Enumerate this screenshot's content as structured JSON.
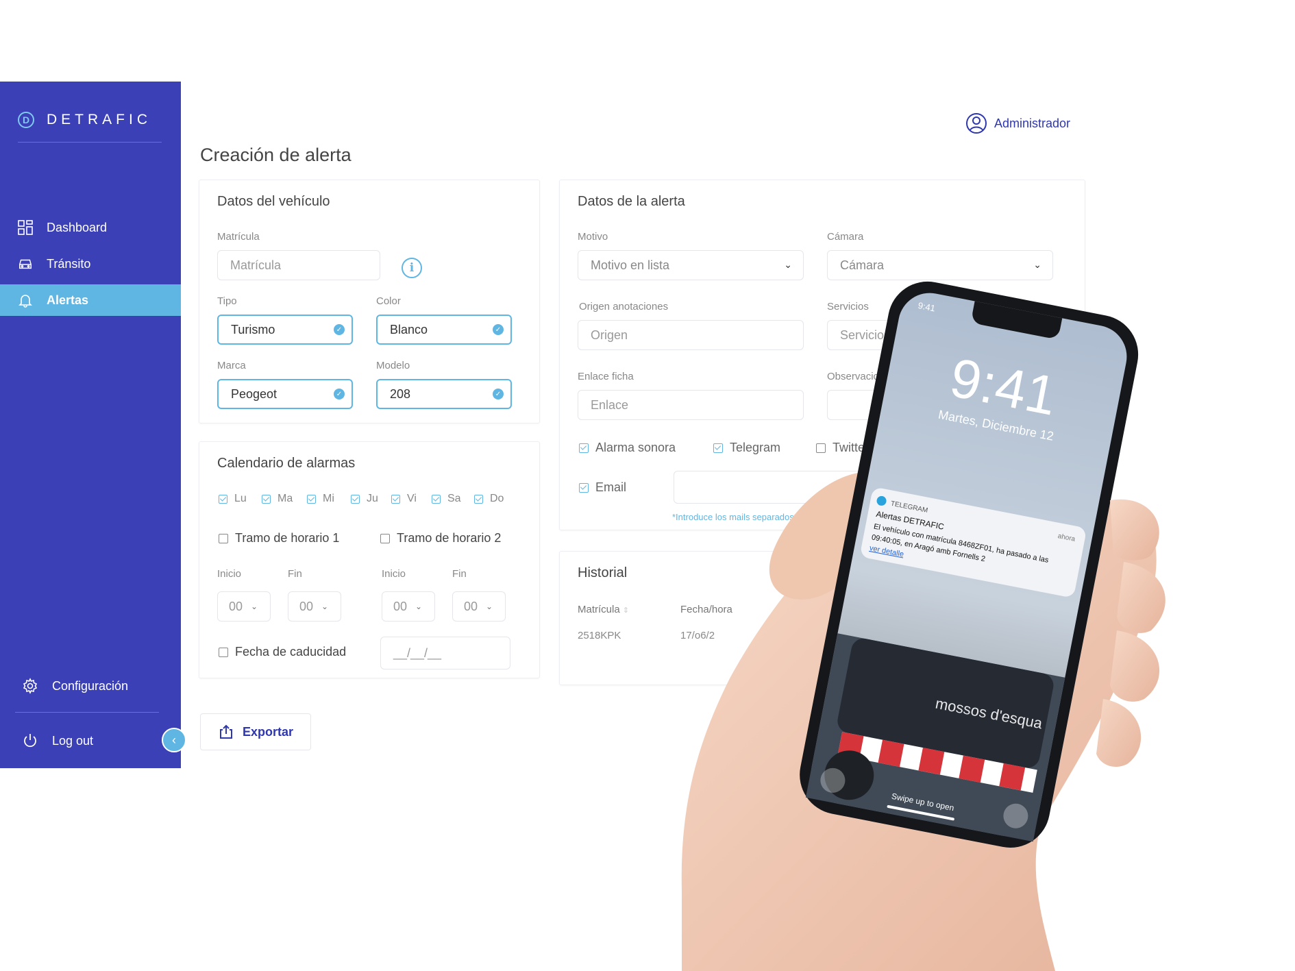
{
  "brand": {
    "logo_letter": "D",
    "name": "DETRAFIC"
  },
  "nav": [
    {
      "label": "Dashboard",
      "icon": "grid-icon",
      "active": false
    },
    {
      "label": "Tránsito",
      "icon": "car-icon",
      "active": false
    },
    {
      "label": "Alertas",
      "icon": "bell-icon",
      "active": true
    }
  ],
  "sidebar_bottom": {
    "settings": "Configuración",
    "logout": "Log out"
  },
  "header": {
    "user": "Administrador"
  },
  "page_title": "Creación de alerta",
  "vehicle": {
    "title": "Datos del vehículo",
    "plate_label": "Matrícula",
    "plate_placeholder": "Matrícula",
    "type_label": "Tipo",
    "type_value": "Turismo",
    "color_label": "Color",
    "color_value": "Blanco",
    "brand_label": "Marca",
    "brand_value": "Peogeot",
    "model_label": "Modelo",
    "model_value": "208"
  },
  "calendar": {
    "title": "Calendario de alarmas",
    "days": [
      "Lu",
      "Ma",
      "Mi",
      "Ju",
      "Vi",
      "Sa",
      "Do"
    ],
    "slot1": "Tramo de horario 1",
    "slot2": "Tramo de horario 2",
    "start_label": "Inicio",
    "end_label": "Fin",
    "time_value": "00",
    "expiry_label": "Fecha de caducidad",
    "expiry_placeholder": "__/__/__"
  },
  "alert": {
    "title": "Datos de la alerta",
    "reason_label": "Motivo",
    "reason_value": "Motivo en lista",
    "camera_label": "Cámara",
    "camera_value": "Cámara",
    "origin_label": "Origen anotaciones",
    "origin_value": "Origen",
    "services_label": "Servicios",
    "services_value": "Servicios",
    "link_label": "Enlace ficha",
    "link_value": "Enlace",
    "notes_label": "Observaciones",
    "opt_sound": "Alarma sonora",
    "opt_telegram": "Telegram",
    "opt_twitter": "Twitter",
    "opt_email": "Email",
    "email_hint": "*Introduce los mails separados por co"
  },
  "history": {
    "title": "Historial",
    "col_plate": "Matrícula",
    "col_datetime": "Fecha/hora",
    "row_plate": "2518KPK",
    "row_datetime": "17/o6/2"
  },
  "export_label": "Exportar",
  "phone": {
    "status_time": "9:41",
    "clock": "9:41",
    "date": "Martes, Diciembre 12",
    "notif_app": "TELEGRAM",
    "notif_when": "ahora",
    "notif_title": "Alertas DETRAFIC",
    "notif_line1": "El vehículo con matrícula 8468ZF01, ha pasado a las",
    "notif_line2": "09:40:05, en Aragó amb Fornells 2",
    "notif_link": "ver detalle",
    "van_text": "mossos d'esqua",
    "swipe": "Swipe up to open"
  }
}
